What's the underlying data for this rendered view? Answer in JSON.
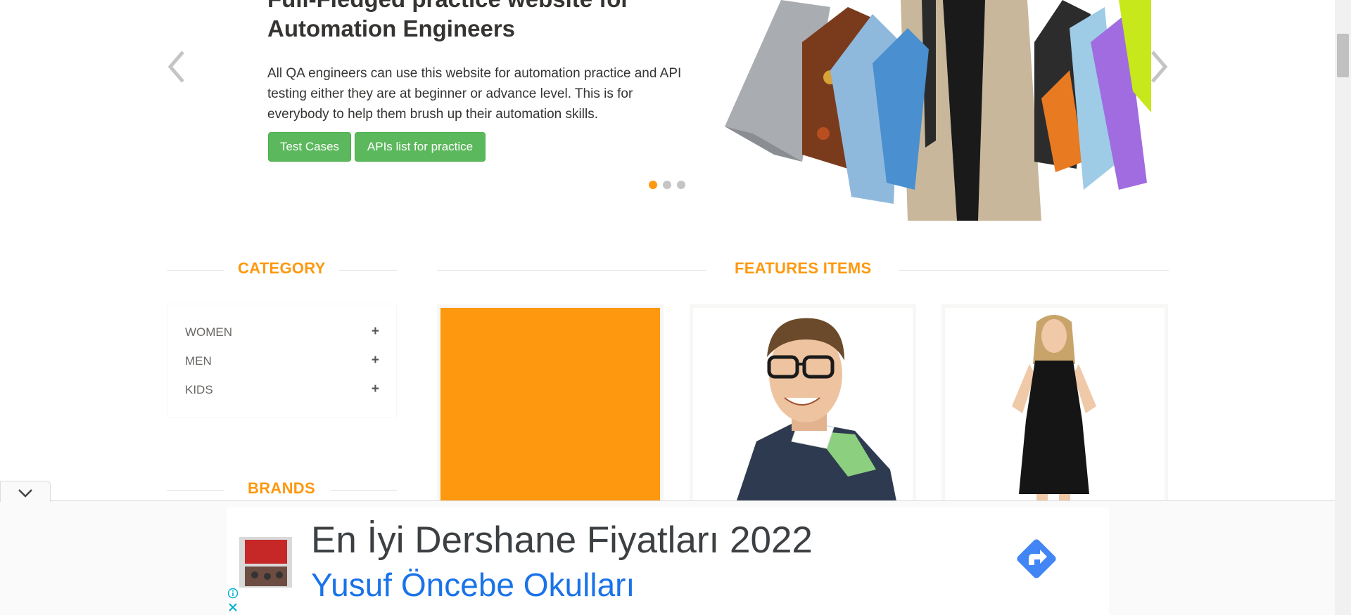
{
  "carousel": {
    "title": "Full-Fledged practice website for Automation Engineers",
    "description": "All QA engineers can use this website for automation practice and API testing either they are at beginner or advance level. This is for everybody to help them brush up their automation skills.",
    "buttons": {
      "test_cases": "Test Cases",
      "apis_list": "APIs list for practice"
    },
    "indicators": [
      "slide-1",
      "slide-2",
      "slide-3"
    ],
    "active_slide": 1,
    "prev_icon": "chevron-left-icon",
    "next_icon": "chevron-right-icon"
  },
  "sidebar": {
    "category_title": "CATEGORY",
    "categories": [
      {
        "label": "WOMEN",
        "icon": "plus-icon"
      },
      {
        "label": "MEN",
        "icon": "plus-icon"
      },
      {
        "label": "KIDS",
        "icon": "plus-icon"
      }
    ],
    "brands_title": "BRANDS"
  },
  "features": {
    "title": "FEATURES ITEMS"
  },
  "ad": {
    "title": "En İyi Dershane Fiyatları 2022",
    "subtitle": "Yusuf Öncebe Okulları",
    "cta_icon": "directions-arrow-icon",
    "info_icon": "info-icon",
    "close_icon": "close-icon",
    "collapse_icon": "chevron-down-icon"
  },
  "colors": {
    "accent": "#fe980f",
    "button": "#5cb85c",
    "ad_link": "#1a73e8",
    "cta": "#4285f4"
  }
}
